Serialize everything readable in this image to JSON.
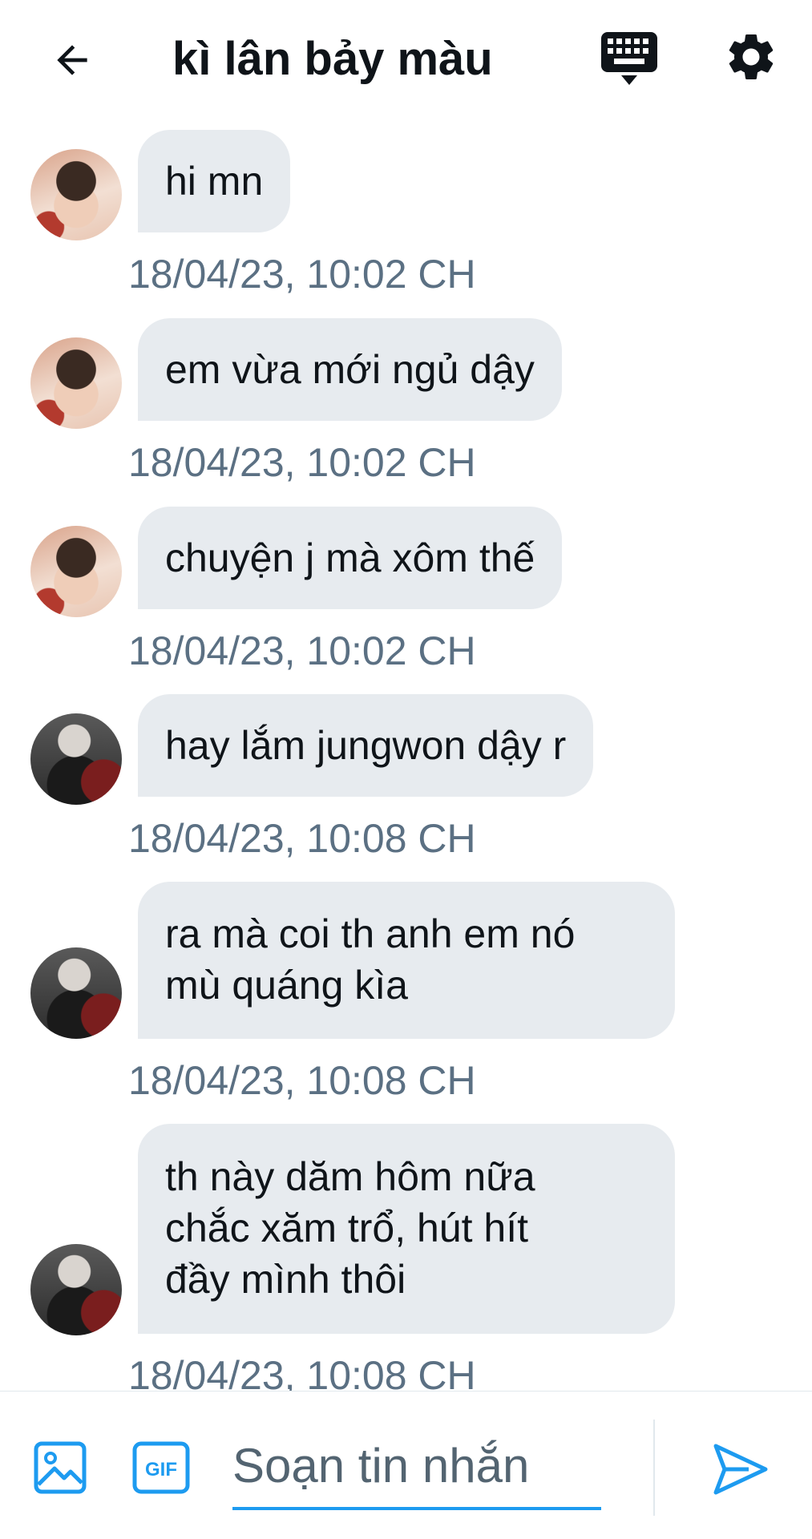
{
  "header": {
    "title": "kì lân bảy màu"
  },
  "messages": [
    {
      "avatar": "avatar-girl-dark-hair",
      "lines": [
        "hi mn"
      ],
      "time": "18/04/23, 10:02 CH"
    },
    {
      "avatar": "avatar-girl-dark-hair",
      "lines": [
        "em vừa mới ngủ dậy"
      ],
      "time": "18/04/23, 10:02 CH"
    },
    {
      "avatar": "avatar-girl-dark-hair",
      "lines": [
        "chuyện j mà xôm thế"
      ],
      "time": "18/04/23, 10:02 CH"
    },
    {
      "avatar": "avatar-boy-silver-hair",
      "lines": [
        "hay lắm jungwon dậy r"
      ],
      "time": "18/04/23, 10:08 CH"
    },
    {
      "avatar": "avatar-boy-silver-hair",
      "lines": [
        "ra mà coi th anh em nó",
        "mù quáng kìa"
      ],
      "time": "18/04/23, 10:08 CH"
    },
    {
      "avatar": "avatar-boy-silver-hair",
      "lines": [
        "th này dăm hôm nữa",
        "chắc xăm trổ, hút hít",
        "đầy mình thôi"
      ],
      "time": "18/04/23, 10:08 CH"
    }
  ],
  "composer": {
    "placeholder": "Soạn tin nhắn",
    "gif_label": "GIF"
  },
  "icons": {
    "back": "arrow-left-icon",
    "keyboard": "keyboard-icon",
    "settings": "gear-icon",
    "media": "image-icon",
    "gif": "gif-icon",
    "send": "send-icon"
  },
  "colors": {
    "accent": "#1d9bf0",
    "bubble": "#e7ebef",
    "timestamp": "#5b7083",
    "text": "#0f1419"
  }
}
